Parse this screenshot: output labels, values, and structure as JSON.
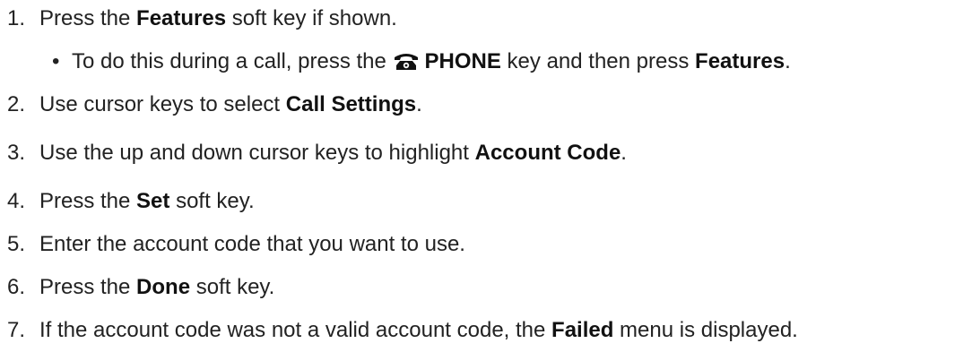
{
  "steps": [
    {
      "number": "1.",
      "parts": [
        "Press the ",
        "Features",
        " soft key if shown."
      ],
      "substeps": [
        {
          "bullet": "•",
          "pre": "To do this during a call, press the ",
          "icon": "phone-icon",
          "key": "PHONE",
          "mid": " key and then press ",
          "feat": "Features",
          "post": "."
        }
      ]
    },
    {
      "number": "2.",
      "parts": [
        "Use cursor keys to select ",
        "Call Settings",
        "."
      ]
    },
    {
      "number": "3.",
      "parts": [
        "Use the up and down cursor keys to highlight ",
        "Account Code",
        "."
      ]
    },
    {
      "number": "4.",
      "parts": [
        "Press the ",
        "Set",
        " soft key."
      ]
    },
    {
      "number": "5.",
      "parts": [
        "Enter the account code that you want to use."
      ]
    },
    {
      "number": "6.",
      "parts": [
        "Press the ",
        "Done",
        " soft key."
      ]
    },
    {
      "number": "7.",
      "parts": [
        "If the account code was not a valid account code, the ",
        "Failed",
        " menu is displayed."
      ]
    }
  ]
}
